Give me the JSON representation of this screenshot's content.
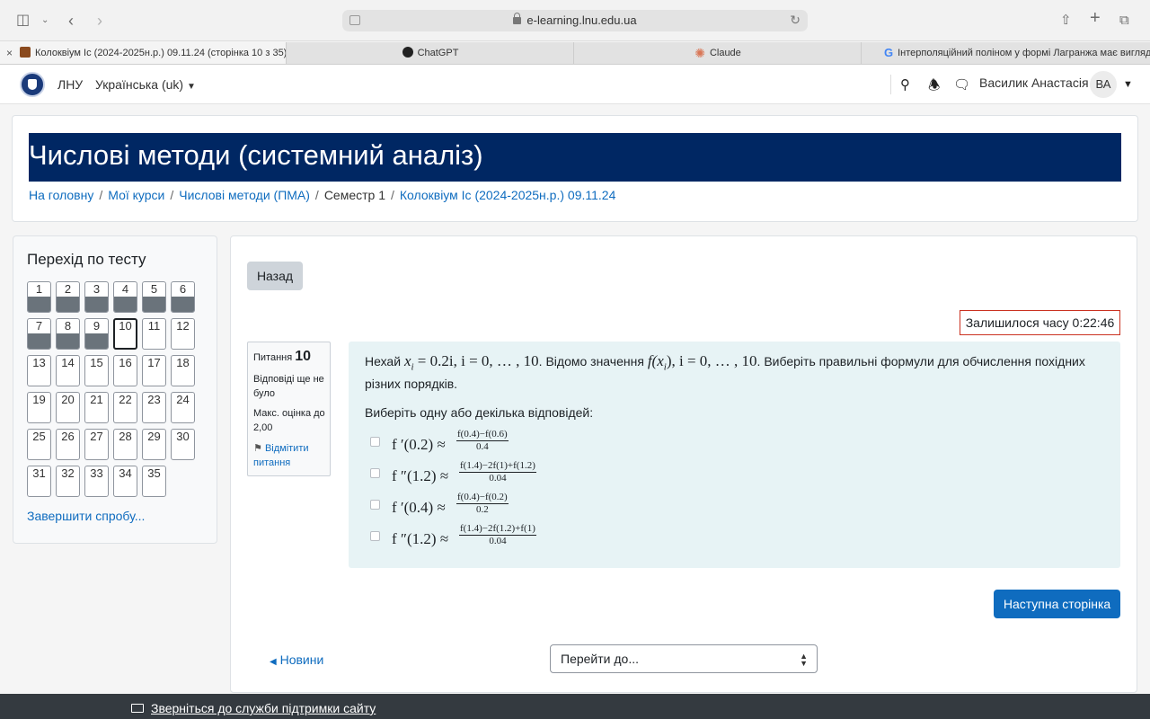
{
  "browser": {
    "url": "e-learning.lnu.edu.ua",
    "tabs": [
      {
        "title": "Колоквіум Іс (2024-2025н.р.) 09.11.24 (сторінка 10 з 35)...",
        "active": true,
        "favicon_color": "#8a4a1e"
      },
      {
        "title": "ChatGPT",
        "active": false,
        "favicon_color": "#222222"
      },
      {
        "title": "Claude",
        "active": false,
        "favicon_color": "#d97757"
      },
      {
        "title": "Інтерполяційний поліном у формі Лагранжа має вигляд...",
        "active": false,
        "favicon_color": "#4285f4"
      }
    ]
  },
  "header": {
    "site_name": "ЛНУ",
    "language": "Українська (uk)",
    "user_name": "Василик Анастасія",
    "user_initials": "ВА"
  },
  "course": {
    "title": "Числові методи (системний аналіз)",
    "breadcrumb": [
      "На головну",
      "Мої курси",
      "Числові методи (ПМА)",
      "Семестр 1",
      "Колоквіум Іс (2024-2025н.р.) 09.11.24"
    ]
  },
  "quiz_nav": {
    "title": "Перехід по тесту",
    "questions": [
      {
        "n": "1",
        "answered": true
      },
      {
        "n": "2",
        "answered": true
      },
      {
        "n": "3",
        "answered": true
      },
      {
        "n": "4",
        "answered": true
      },
      {
        "n": "5",
        "answered": true
      },
      {
        "n": "6",
        "answered": true
      },
      {
        "n": "7",
        "answered": true
      },
      {
        "n": "8",
        "answered": true
      },
      {
        "n": "9",
        "answered": true
      },
      {
        "n": "10",
        "answered": false,
        "current": true
      },
      {
        "n": "11",
        "answered": false
      },
      {
        "n": "12",
        "answered": false
      },
      {
        "n": "13",
        "answered": false
      },
      {
        "n": "14",
        "answered": false
      },
      {
        "n": "15",
        "answered": false
      },
      {
        "n": "16",
        "answered": false
      },
      {
        "n": "17",
        "answered": false
      },
      {
        "n": "18",
        "answered": false
      },
      {
        "n": "19",
        "answered": false
      },
      {
        "n": "20",
        "answered": false
      },
      {
        "n": "21",
        "answered": false
      },
      {
        "n": "22",
        "answered": false
      },
      {
        "n": "23",
        "answered": false
      },
      {
        "n": "24",
        "answered": false
      },
      {
        "n": "25",
        "answered": false
      },
      {
        "n": "26",
        "answered": false
      },
      {
        "n": "27",
        "answered": false
      },
      {
        "n": "28",
        "answered": false
      },
      {
        "n": "29",
        "answered": false
      },
      {
        "n": "30",
        "answered": false
      },
      {
        "n": "31",
        "answered": false
      },
      {
        "n": "32",
        "answered": false
      },
      {
        "n": "33",
        "answered": false
      },
      {
        "n": "34",
        "answered": false
      },
      {
        "n": "35",
        "answered": false
      }
    ],
    "finish_label": "Завершити спробу..."
  },
  "main": {
    "back_label": "Назад",
    "timer": "Залишилося часу 0:22:46",
    "question_info": {
      "label": "Питання",
      "number": "10",
      "state": "Відповіді ще не було",
      "grade": "Макс. оцінка до 2,00",
      "flag_label": "Відмітити питання"
    },
    "question": {
      "intro": "Нехай",
      "cond1": "x",
      "cond1_sub": "i",
      "cond1_rest": " = 0.2i, i = 0, … , 10",
      "text_mid": ". Відомо значення",
      "fx": "f(x",
      "fx_sub": "i",
      "fx_rest": "), i = 0, … , 10",
      "text_end": ". Виберіть  правильні формули для обчислення похідних різних порядків.",
      "prompt": "Виберіть одну або декілька відповідей:",
      "options": [
        {
          "lhs": "f ′(0.2) ≈",
          "num": "f(0.4)−f(0.6)",
          "den": "0.4",
          "checked": false
        },
        {
          "lhs": "f ″(1.2) ≈",
          "num": "f(1.4)−2f(1)+f(1.2)",
          "den": "0.04",
          "checked": false
        },
        {
          "lhs": "f ′(0.4) ≈",
          "num": "f(0.4)−f(0.2)",
          "den": "0.2",
          "checked": false
        },
        {
          "lhs": "f ″(1.2) ≈",
          "num": "f(1.4)−2f(1.2)+f(1)",
          "den": "0.04",
          "checked": false
        }
      ]
    },
    "next_label": "Наступна сторінка",
    "news_label": "Новини",
    "jump_placeholder": "Перейти до..."
  },
  "footer": {
    "support_label": "Зверніться до служби підтримки сайту"
  },
  "colors": {
    "course_title_bg": "#002763",
    "link": "#0f6cbf",
    "primary_button": "#0f6cbf",
    "timer_border": "#ca3120",
    "question_bg": "#e7f3f5",
    "footer_bg": "#343a40",
    "answered_fill": "#6a737b"
  }
}
